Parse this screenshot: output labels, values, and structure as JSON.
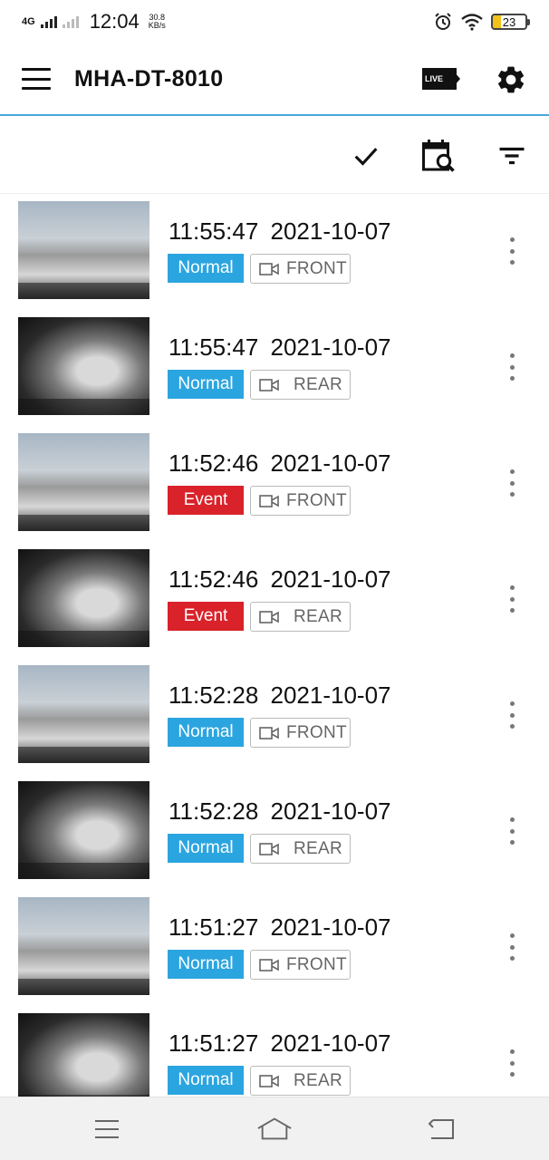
{
  "status_bar": {
    "network": "4G",
    "time": "12:04",
    "speed_value": "30.8",
    "speed_unit": "KB/s",
    "battery": "23"
  },
  "app_bar": {
    "title": "MHA-DT-8010",
    "live_label": "LIVE",
    "icons": [
      "menu-icon",
      "live-camera-icon",
      "gear-icon"
    ]
  },
  "toolbar": {
    "icons": [
      "check-icon",
      "calendar-search-icon",
      "filter-icon"
    ]
  },
  "colors": {
    "accent": "#4aa8d8",
    "normal": "#2ba5e0",
    "event": "#d9222a"
  },
  "recordings": [
    {
      "time": "11:55:47",
      "date": "2021-10-07",
      "status": "Normal",
      "camera": "FRONT"
    },
    {
      "time": "11:55:47",
      "date": "2021-10-07",
      "status": "Normal",
      "camera": "REAR"
    },
    {
      "time": "11:52:46",
      "date": "2021-10-07",
      "status": "Event",
      "camera": "FRONT"
    },
    {
      "time": "11:52:46",
      "date": "2021-10-07",
      "status": "Event",
      "camera": "REAR"
    },
    {
      "time": "11:52:28",
      "date": "2021-10-07",
      "status": "Normal",
      "camera": "FRONT"
    },
    {
      "time": "11:52:28",
      "date": "2021-10-07",
      "status": "Normal",
      "camera": "REAR"
    },
    {
      "time": "11:51:27",
      "date": "2021-10-07",
      "status": "Normal",
      "camera": "FRONT"
    },
    {
      "time": "11:51:27",
      "date": "2021-10-07",
      "status": "Normal",
      "camera": "REAR"
    }
  ],
  "nav_bar": {
    "icons": [
      "recents-icon",
      "home-icon",
      "back-icon"
    ]
  }
}
